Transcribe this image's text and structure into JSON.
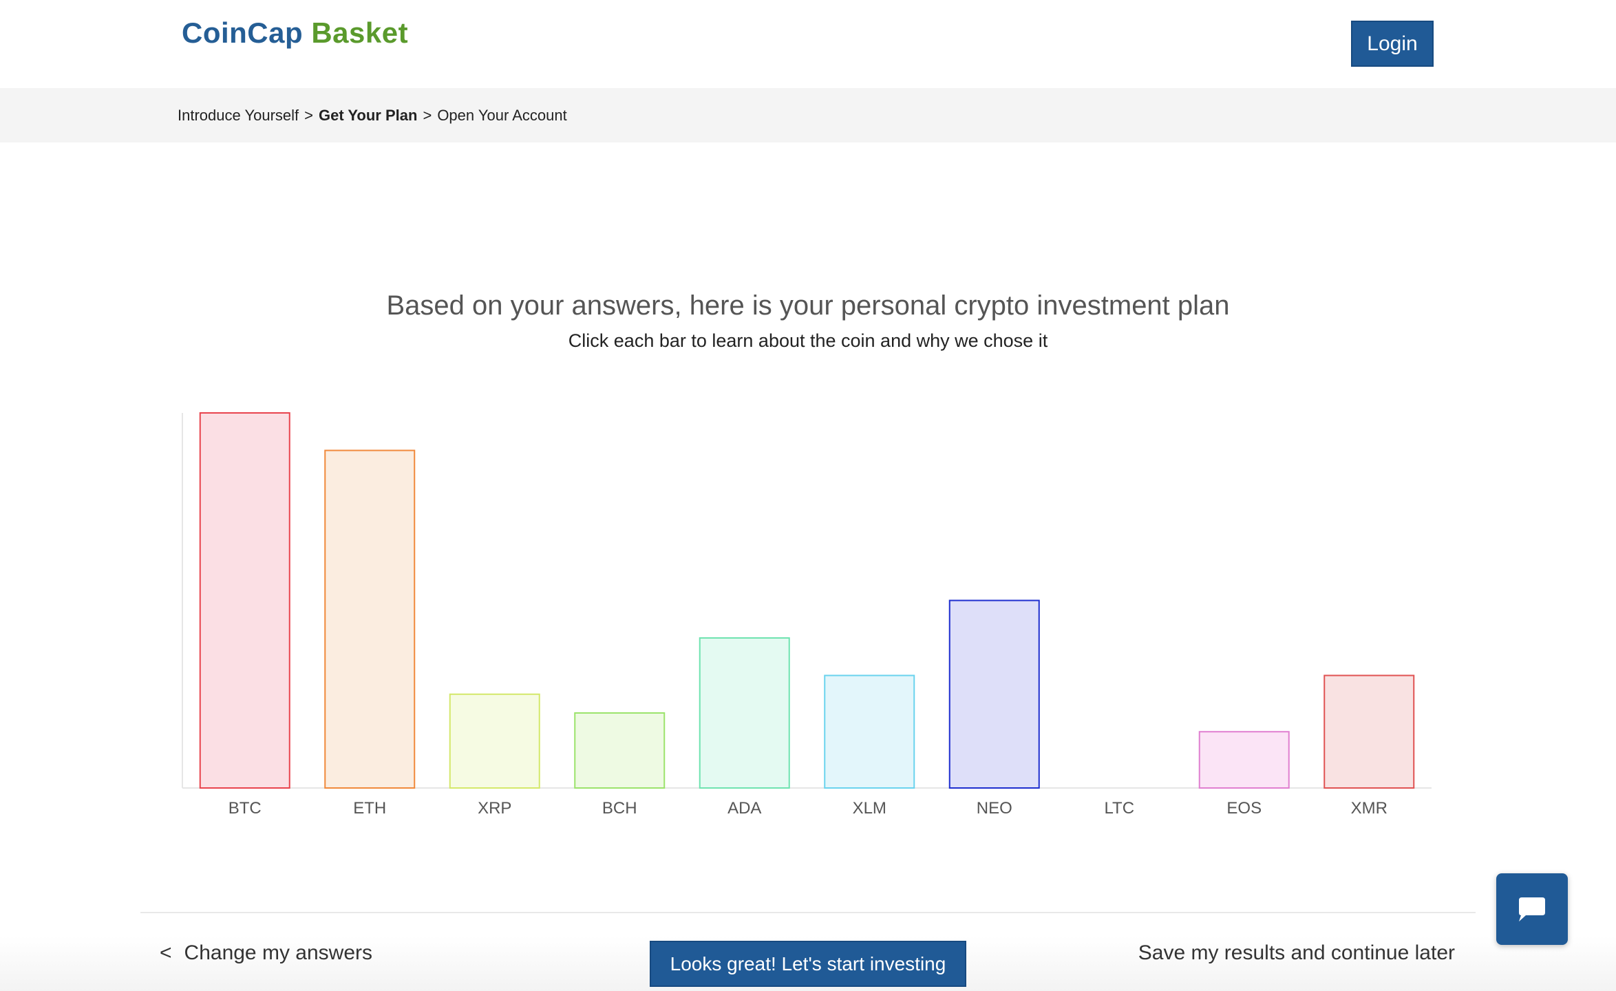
{
  "brand": {
    "part1": "CoinCap",
    "part2": "Basket"
  },
  "header": {
    "login_label": "Login"
  },
  "breadcrumb": {
    "steps": [
      {
        "label": "Introduce Yourself",
        "active": false
      },
      {
        "label": "Get Your Plan",
        "active": true
      },
      {
        "label": "Open Your Account",
        "active": false
      }
    ],
    "separator": ">"
  },
  "main": {
    "title": "Based on your answers, here is your personal crypto investment plan",
    "subtitle": "Click each bar to learn about the coin and why we chose it"
  },
  "chart_data": {
    "type": "bar",
    "categories": [
      "BTC",
      "ETH",
      "XRP",
      "BCH",
      "ADA",
      "XLM",
      "NEO",
      "LTC",
      "EOS",
      "XMR"
    ],
    "values": [
      20,
      18,
      5,
      4,
      8,
      6,
      10,
      0,
      3,
      6
    ],
    "ylim": [
      0,
      20
    ],
    "grid": false,
    "legend": "none",
    "colors": {
      "stroke": [
        "#e8434d",
        "#f0893b",
        "#d4e86a",
        "#9be36b",
        "#6fe3b0",
        "#6ad3ee",
        "#1e2ecf",
        "#aaaaaa",
        "#e07fd0",
        "#e05252"
      ],
      "fill": [
        "#fbdfe4",
        "#fbede0",
        "#f6fbe3",
        "#eefae3",
        "#e4faf2",
        "#e3f6fb",
        "#dedff9",
        "#eeeeee",
        "#fbe4f6",
        "#f9e2e2"
      ]
    }
  },
  "footer": {
    "back_chevron": "<",
    "change_label": "Change my answers",
    "start_label": "Looks great! Let's start investing",
    "save_label": "Save my results and continue later"
  },
  "chat": {
    "icon": "chat-bubble-icon"
  },
  "colors": {
    "primary": "#205a96",
    "brand_blue": "#255e95",
    "brand_green": "#5a9a2c",
    "crumb_bg": "#f4f4f4"
  }
}
